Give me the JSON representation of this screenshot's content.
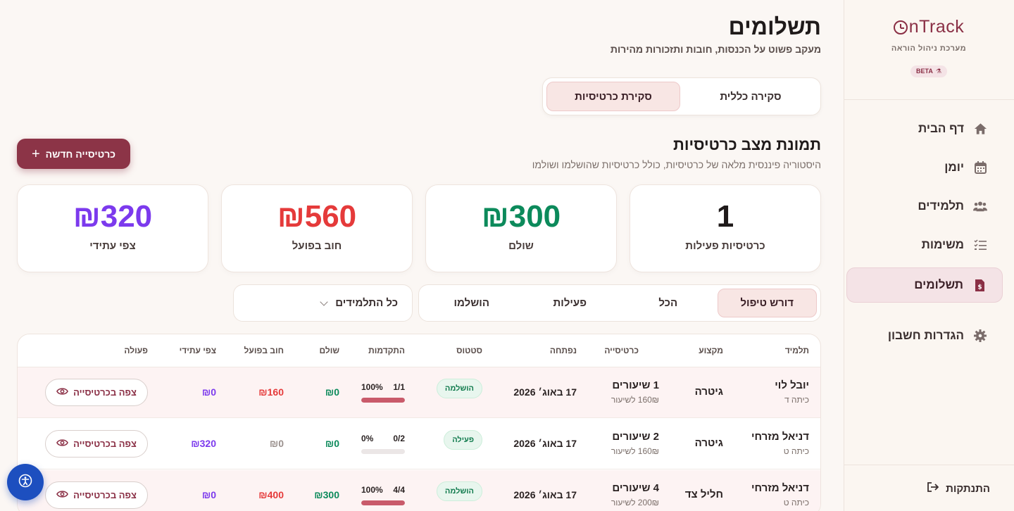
{
  "sidebar": {
    "logo": "OnTrack",
    "subtitle": "מערכת ניהול הוראה",
    "beta": "BETA",
    "items": [
      {
        "label": "דף הבית",
        "icon": "home-icon"
      },
      {
        "label": "יומן",
        "icon": "calendar-icon"
      },
      {
        "label": "תלמידים",
        "icon": "users-icon"
      },
      {
        "label": "משימות",
        "icon": "tasks-icon"
      },
      {
        "label": "תשלומים",
        "icon": "payment-icon",
        "active": true
      },
      {
        "label": "הגדרות חשבון",
        "icon": "gear-icon"
      }
    ],
    "logout": "התנתקות"
  },
  "header": {
    "title": "תשלומים",
    "subtitle": "מעקב פשוט על הכנסות, חובות ותזכורות מהירות"
  },
  "view_toggle": {
    "options": [
      "סקירה כללית",
      "סקירת כרטיסיות"
    ],
    "selected": "סקירת כרטיסיות"
  },
  "section": {
    "title": "תמונת מצב כרטיסיות",
    "subtitle": "היסטוריה פיננסית מלאה של כרטיסיות, כולל כרטיסיות שהושלמו ושולמו",
    "new_button": "כרטיסייה חדשה"
  },
  "stats": [
    {
      "value": "1",
      "label": "כרטיסיות פעילות",
      "color": "#1f1a1a"
    },
    {
      "value": "₪300",
      "label": "שולם",
      "color": "#0c8a5b"
    },
    {
      "value": "₪560",
      "label": "חוב בפועל",
      "color": "#e53a3a"
    },
    {
      "value": "₪320",
      "label": "צפי עתידי",
      "color": "#7c3aed"
    }
  ],
  "filters": {
    "tabs": [
      "דורש טיפול",
      "הכל",
      "פעילות",
      "הושלמו"
    ],
    "selected_tab": "דורש טיפול",
    "student_select": "כל התלמידים"
  },
  "table": {
    "headers": {
      "student": "תלמיד",
      "subject": "מקצוע",
      "card": "כרטיסייה",
      "opened": "נפתחה",
      "status": "סטטוס",
      "progress": "התקדמות",
      "paid": "שולם",
      "debt": "חוב בפועל",
      "forecast": "צפי עתידי",
      "action": "פעולה"
    },
    "rows": [
      {
        "name": "יובל לוי",
        "grade": "כיתה ד",
        "subject": "גיטרה",
        "lessons": "1 שיעורים",
        "rate": "160₪ לשיעור",
        "date": "17 באוג׳ 2026",
        "status": "הושלמה",
        "progress_count": "1/1",
        "progress_pct": "100%",
        "progress_value": 1.0,
        "paid": "₪0",
        "debt": "₪160",
        "debt_color": "#e53a3a",
        "forecast": "₪0",
        "action": "צפה בכרטיסייה"
      },
      {
        "name": "דניאל מזרחי",
        "grade": "כיתה ט",
        "subject": "גיטרה",
        "lessons": "2 שיעורים",
        "rate": "160₪ לשיעור",
        "date": "17 באוג׳ 2026",
        "status": "פעילה",
        "progress_count": "0/2",
        "progress_pct": "0%",
        "progress_value": 0.0,
        "paid": "₪0",
        "debt": "₪0",
        "debt_color": "#9a908d",
        "forecast": "₪320",
        "action": "צפה בכרטיסייה"
      },
      {
        "name": "דניאל מזרחי",
        "grade": "כיתה ט",
        "subject": "חליל צד",
        "lessons": "4 שיעורים",
        "rate": "200₪ לשיעור",
        "date": "17 באוג׳ 2026",
        "status": "הושלמה",
        "progress_count": "4/4",
        "progress_pct": "100%",
        "progress_value": 1.0,
        "paid": "₪300",
        "debt": "₪400",
        "debt_color": "#e53a3a",
        "forecast": "₪0",
        "action": "צפה בכרטיסייה"
      }
    ]
  },
  "colors": {
    "accent": "#8c3447",
    "paid": "#0c8a5b",
    "debt": "#e53a3a",
    "forecast": "#7c3aed"
  }
}
